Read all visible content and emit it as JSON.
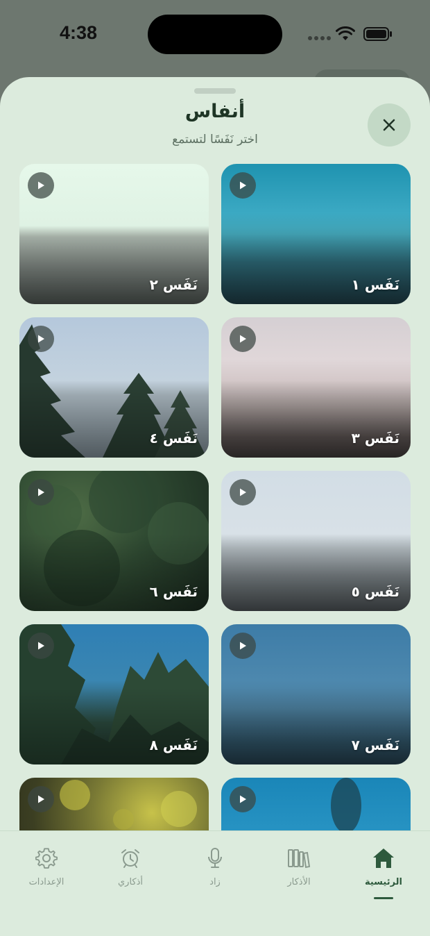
{
  "status_bar": {
    "time": "4:38"
  },
  "sheet": {
    "title": "أنفاس",
    "subtitle": "اختر نَفَسًا لتستمع",
    "close_icon": "close-icon"
  },
  "cards": [
    {
      "label": "نَفَس ١",
      "theme": "teal-sky"
    },
    {
      "label": "نَفَس ٢",
      "theme": "pale-mint"
    },
    {
      "label": "نَفَس ٣",
      "theme": "pink-dusk"
    },
    {
      "label": "نَفَس ٤",
      "theme": "pine-trees"
    },
    {
      "label": "نَفَس ٥",
      "theme": "grey-sky"
    },
    {
      "label": "نَفَس ٦",
      "theme": "dark-forest"
    },
    {
      "label": "نَفَس ٧",
      "theme": "blue-clouds"
    },
    {
      "label": "نَفَس ٨",
      "theme": "tree-canopy"
    },
    {
      "label": "",
      "theme": "blue-water"
    },
    {
      "label": "",
      "theme": "yellow-bokeh"
    }
  ],
  "tabs": [
    {
      "label": "الرئيسية",
      "icon": "home-icon",
      "active": true
    },
    {
      "label": "الأذكار",
      "icon": "books-icon",
      "active": false
    },
    {
      "label": "زاد",
      "icon": "microphone-icon",
      "active": false
    },
    {
      "label": "أذكاري",
      "icon": "alarm-clock-icon",
      "active": false
    },
    {
      "label": "الإعدادات",
      "icon": "gear-icon",
      "active": false
    }
  ],
  "colors": {
    "accent": "#2e5a3d",
    "sheet_background": "#dcebdd",
    "inactive_tab": "#8a9a8e"
  }
}
